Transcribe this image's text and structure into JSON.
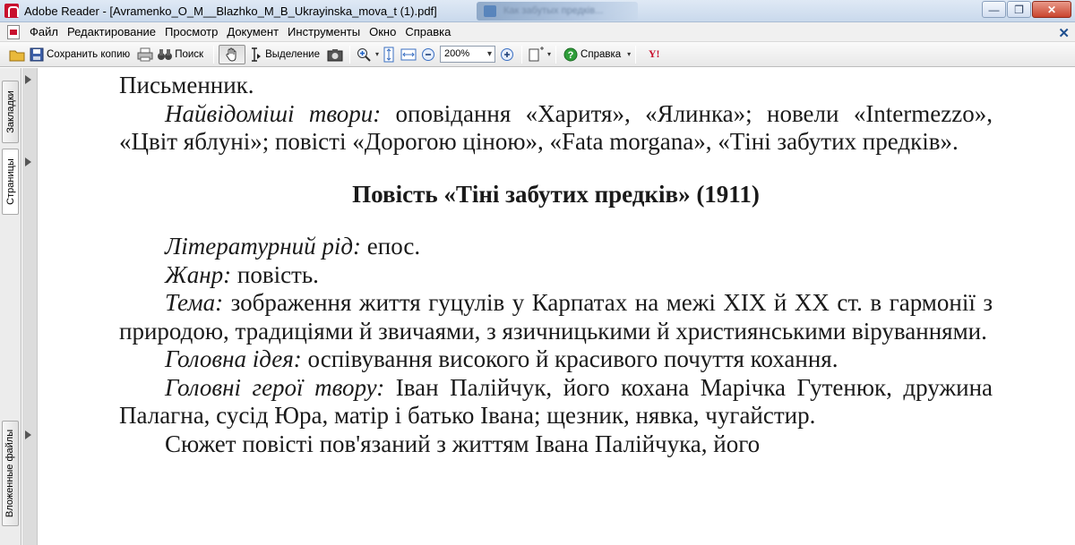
{
  "window": {
    "title": "Adobe Reader - [Avramenko_O_M__Blazhko_M_B_Ukrayinska_mova_t (1).pdf]",
    "background_tab_text": "Как забутых предків...",
    "minimize": "—",
    "restore": "❐",
    "close": "✕"
  },
  "menu": {
    "items": [
      "Файл",
      "Редактирование",
      "Просмотр",
      "Документ",
      "Инструменты",
      "Окно",
      "Справка"
    ],
    "close_doc": "✕"
  },
  "toolbar": {
    "save_copy": "Сохранить копию",
    "search": "Поиск",
    "select": "Выделение",
    "zoom_value": "200%",
    "help": "Справка",
    "yahoo": "Y!"
  },
  "sidepanel": {
    "tabs": [
      "Закладки",
      "Страницы",
      "Вложенные файлы"
    ]
  },
  "document": {
    "line_writer": "Письменник.",
    "works_label": "Найвідоміші твори:",
    "works_text": " оповідання «Харитя», «Ялинка»; новели «Intermezzo», «Цвіт яблуні»; повісті «Дорогою ціною», «Fata morgana», «Тіні забутих предків».",
    "heading": "Повість «Тіні забутих предків» (1911)",
    "genre_kind_label": "Літературний рід:",
    "genre_kind_text": " епос.",
    "genre_label": "Жанр:",
    "genre_text": " повість.",
    "theme_label": "Тема:",
    "theme_text": " зображення життя гуцулів у Карпатах на межі XIX й XX ст. в гармонії з природою, традиціями й звичаями, з язичницькими й християнськими віруваннями.",
    "idea_label": "Головна ідея:",
    "idea_text": " оспівування високого й красивого почуття кохання.",
    "heroes_label": "Головні герої твору:",
    "heroes_text": " Іван Палійчук, його кохана Марічка Гутенюк, дружина Палагна, сусід Юра, матір і батько Івана; щезник, нявка, чугайстир.",
    "cut_line": "Сюжет повісті пов'язаний з життям Івана Палійчука, його"
  }
}
